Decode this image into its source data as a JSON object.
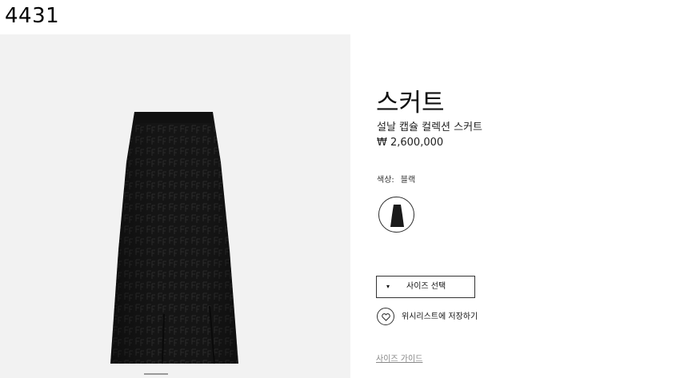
{
  "page_id": "4431",
  "product": {
    "title": "스커트",
    "subtitle": "설날 캡슐 컬렉션 스커트",
    "price": "₩ 2,600,000"
  },
  "color": {
    "label": "색상:",
    "value": "블랙",
    "swatch_color": "#1a1a1a"
  },
  "size_select": {
    "label": "사이즈 선택",
    "caret": "▾"
  },
  "wishlist": {
    "label": "위시리스트에 저장하기",
    "icon": "heart-icon"
  },
  "size_guide": {
    "label": "사이즈 가이드"
  },
  "colors": {
    "image_bg": "#f2f2f2",
    "skirt": "#151515",
    "text": "#111111",
    "muted": "#888888"
  }
}
